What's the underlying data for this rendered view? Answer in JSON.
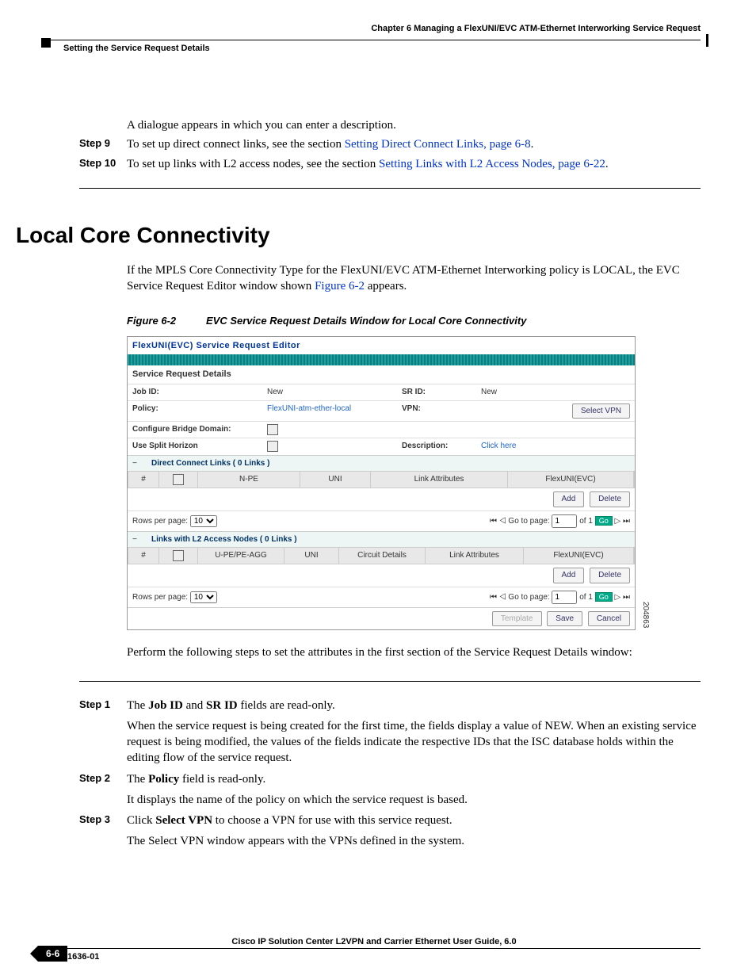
{
  "header": {
    "chapter": "Chapter 6      Managing a FlexUNI/EVC ATM-Ethernet Interworking Service Request",
    "section": "Setting the Service Request Details"
  },
  "intro": {
    "dialog": "A dialogue appears in which you can enter a description.",
    "step9_label": "Step 9",
    "step9_text_a": "To set up direct connect links, see the section ",
    "step9_link": "Setting Direct Connect Links, page 6-8",
    "step9_text_b": ".",
    "step10_label": "Step 10",
    "step10_text_a": "To set up links with L2 access nodes, see the section ",
    "step10_link": "Setting Links with L2 Access Nodes, page 6-22",
    "step10_text_b": "."
  },
  "title": "Local Core Connectivity",
  "para1a": "If the MPLS Core Connectivity Type for the FlexUNI/EVC ATM-Ethernet Interworking policy is LOCAL, the EVC Service Request Editor window shown ",
  "para1link": "Figure 6-2",
  "para1b": " appears.",
  "fig": {
    "num": "Figure 6-2",
    "caption": "EVC Service Request Details Window for Local Core Connectivity",
    "editor_title": "FlexUNI(EVC) Service Request Editor",
    "details_title": "Service Request Details",
    "jobid_lbl": "Job ID:",
    "jobid_val": "New",
    "srid_lbl": "SR ID:",
    "srid_val": "New",
    "policy_lbl": "Policy:",
    "policy_val": "FlexUNI-atm-ether-local",
    "vpn_lbl": "VPN:",
    "selectvpn": "Select VPN",
    "bridge_lbl": "Configure Bridge Domain:",
    "split_lbl": "Use Split Horizon",
    "desc_lbl": "Description:",
    "desc_val": "Click here",
    "direct_title": "Direct Connect Links  ( 0 Links )",
    "l2_title": "Links with L2 Access Nodes  ( 0 Links )",
    "cols_d": {
      "num": "#",
      "npe": "N-PE",
      "uni": "UNI",
      "la": "Link Attributes",
      "flex": "FlexUNI(EVC)"
    },
    "cols_l": {
      "num": "#",
      "upe": "U-PE/PE-AGG",
      "uni": "UNI",
      "cd": "Circuit Details",
      "la": "Link Attributes",
      "flex": "FlexUNI(EVC)"
    },
    "add": "Add",
    "delete": "Delete",
    "rows_lbl": "Rows per page:",
    "rows_val": "10",
    "goto": "Go to page:",
    "goto_val": "1",
    "of": "of 1",
    "go": "Go",
    "template": "Template",
    "save": "Save",
    "cancel": "Cancel",
    "sidenum": "204863"
  },
  "para2": "Perform the following steps to set the attributes in the first section of the Service Request Details window:",
  "steps": {
    "s1_label": "Step 1",
    "s1_a": "The ",
    "s1_b": "Job ID",
    "s1_c": " and ",
    "s1_d": "SR ID",
    "s1_e": " fields are read-only.",
    "s1_p": "When the service request is being created for the first time, the fields display a value of NEW. When an existing service request is being modified, the values of the fields indicate the respective IDs that the ISC database holds within the editing flow of the service request.",
    "s2_label": "Step 2",
    "s2_a": "The ",
    "s2_b": "Policy",
    "s2_c": " field is read-only.",
    "s2_p": "It displays the name of the policy on which the service request is based.",
    "s3_label": "Step 3",
    "s3_a": "Click ",
    "s3_b": "Select VPN",
    "s3_c": " to choose a VPN for use with this service request.",
    "s3_p": "The Select VPN window appears with the VPNs defined in the system."
  },
  "footer": {
    "title": "Cisco IP Solution Center L2VPN and Carrier Ethernet User Guide, 6.0",
    "page": "6-6",
    "ol": "OL-21636-01"
  }
}
